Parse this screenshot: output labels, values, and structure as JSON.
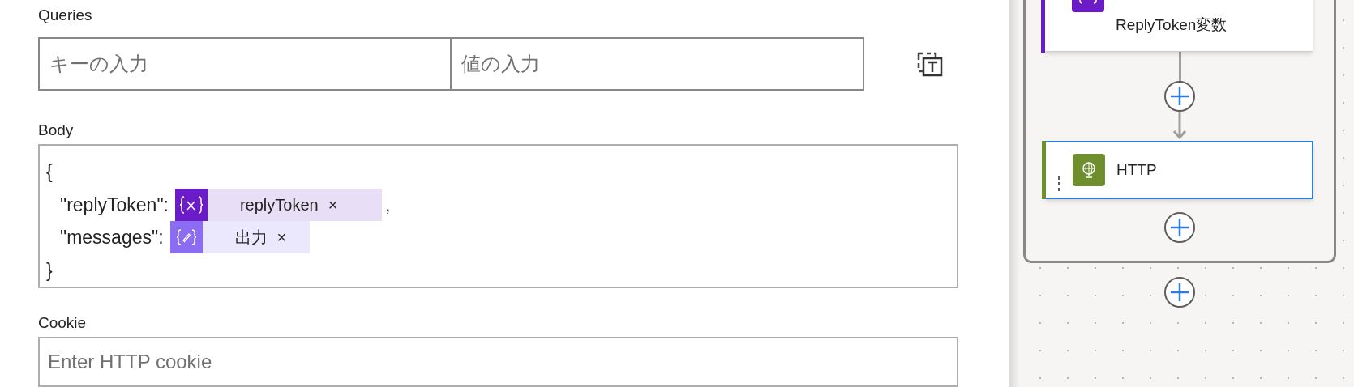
{
  "queries": {
    "label": "Queries",
    "key_placeholder": "キーの入力",
    "value_placeholder": "値の入力"
  },
  "body": {
    "label": "Body",
    "lines": [
      {
        "text": "{"
      },
      {
        "text": "\"replyToken\":",
        "token": {
          "kind": "variable",
          "label": "replyToken",
          "remove": "×"
        },
        "suffix": ","
      },
      {
        "text": "\"messages\":",
        "token": {
          "kind": "expression",
          "label": "出力",
          "remove": "×"
        }
      },
      {
        "text": "}"
      }
    ]
  },
  "cookie": {
    "label": "Cookie",
    "placeholder": "Enter HTTP cookie"
  },
  "flow": {
    "steps": [
      {
        "kind": "variable",
        "title_lines": [
          "ReplyToken変数"
        ],
        "selected": false
      },
      {
        "kind": "http",
        "title_lines": [
          "HTTP"
        ],
        "selected": true
      }
    ]
  }
}
